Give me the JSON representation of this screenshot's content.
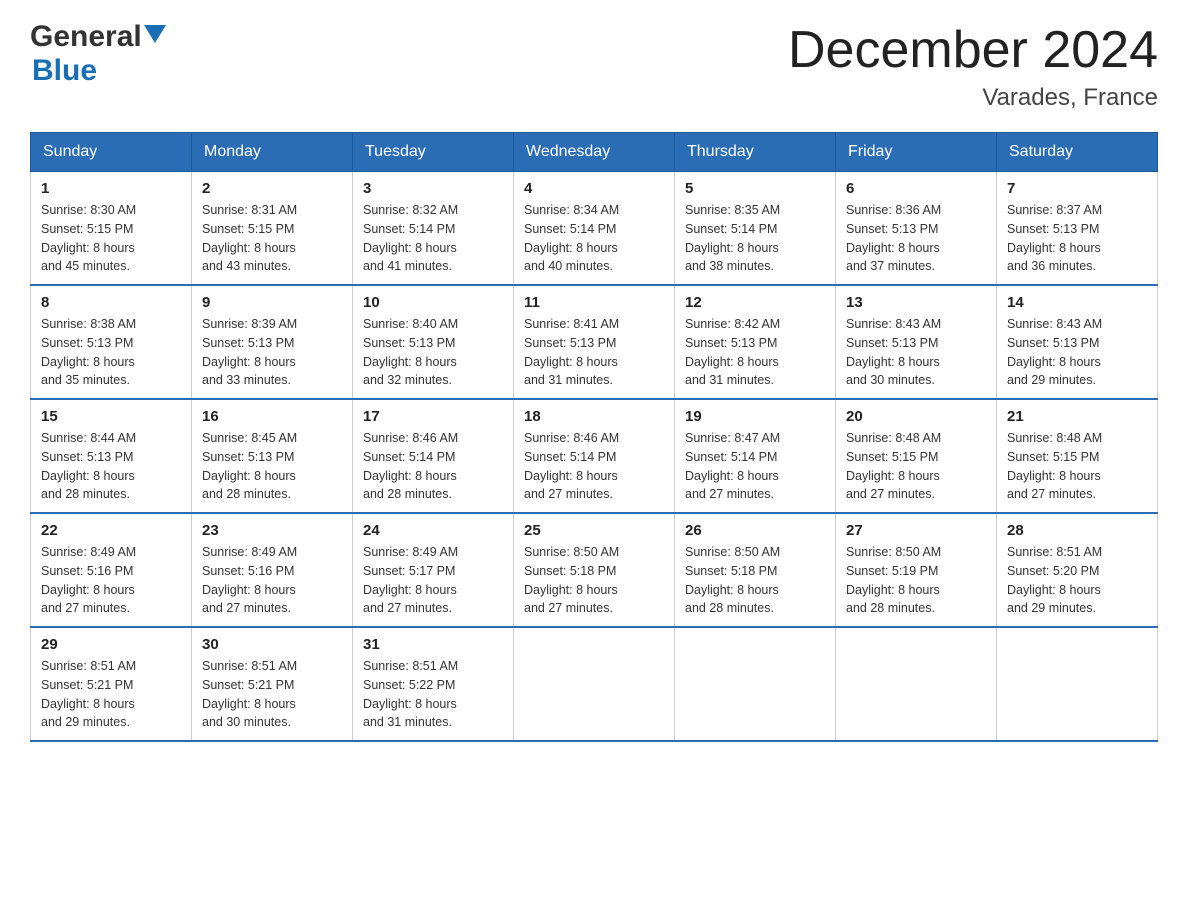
{
  "logo": {
    "general": "General",
    "blue": "Blue"
  },
  "title": "December 2024",
  "subtitle": "Varades, France",
  "days_of_week": [
    "Sunday",
    "Monday",
    "Tuesday",
    "Wednesday",
    "Thursday",
    "Friday",
    "Saturday"
  ],
  "weeks": [
    [
      {
        "day": "1",
        "sunrise": "8:30 AM",
        "sunset": "5:15 PM",
        "daylight": "8 hours and 45 minutes."
      },
      {
        "day": "2",
        "sunrise": "8:31 AM",
        "sunset": "5:15 PM",
        "daylight": "8 hours and 43 minutes."
      },
      {
        "day": "3",
        "sunrise": "8:32 AM",
        "sunset": "5:14 PM",
        "daylight": "8 hours and 41 minutes."
      },
      {
        "day": "4",
        "sunrise": "8:34 AM",
        "sunset": "5:14 PM",
        "daylight": "8 hours and 40 minutes."
      },
      {
        "day": "5",
        "sunrise": "8:35 AM",
        "sunset": "5:14 PM",
        "daylight": "8 hours and 38 minutes."
      },
      {
        "day": "6",
        "sunrise": "8:36 AM",
        "sunset": "5:13 PM",
        "daylight": "8 hours and 37 minutes."
      },
      {
        "day": "7",
        "sunrise": "8:37 AM",
        "sunset": "5:13 PM",
        "daylight": "8 hours and 36 minutes."
      }
    ],
    [
      {
        "day": "8",
        "sunrise": "8:38 AM",
        "sunset": "5:13 PM",
        "daylight": "8 hours and 35 minutes."
      },
      {
        "day": "9",
        "sunrise": "8:39 AM",
        "sunset": "5:13 PM",
        "daylight": "8 hours and 33 minutes."
      },
      {
        "day": "10",
        "sunrise": "8:40 AM",
        "sunset": "5:13 PM",
        "daylight": "8 hours and 32 minutes."
      },
      {
        "day": "11",
        "sunrise": "8:41 AM",
        "sunset": "5:13 PM",
        "daylight": "8 hours and 31 minutes."
      },
      {
        "day": "12",
        "sunrise": "8:42 AM",
        "sunset": "5:13 PM",
        "daylight": "8 hours and 31 minutes."
      },
      {
        "day": "13",
        "sunrise": "8:43 AM",
        "sunset": "5:13 PM",
        "daylight": "8 hours and 30 minutes."
      },
      {
        "day": "14",
        "sunrise": "8:43 AM",
        "sunset": "5:13 PM",
        "daylight": "8 hours and 29 minutes."
      }
    ],
    [
      {
        "day": "15",
        "sunrise": "8:44 AM",
        "sunset": "5:13 PM",
        "daylight": "8 hours and 28 minutes."
      },
      {
        "day": "16",
        "sunrise": "8:45 AM",
        "sunset": "5:13 PM",
        "daylight": "8 hours and 28 minutes."
      },
      {
        "day": "17",
        "sunrise": "8:46 AM",
        "sunset": "5:14 PM",
        "daylight": "8 hours and 28 minutes."
      },
      {
        "day": "18",
        "sunrise": "8:46 AM",
        "sunset": "5:14 PM",
        "daylight": "8 hours and 27 minutes."
      },
      {
        "day": "19",
        "sunrise": "8:47 AM",
        "sunset": "5:14 PM",
        "daylight": "8 hours and 27 minutes."
      },
      {
        "day": "20",
        "sunrise": "8:48 AM",
        "sunset": "5:15 PM",
        "daylight": "8 hours and 27 minutes."
      },
      {
        "day": "21",
        "sunrise": "8:48 AM",
        "sunset": "5:15 PM",
        "daylight": "8 hours and 27 minutes."
      }
    ],
    [
      {
        "day": "22",
        "sunrise": "8:49 AM",
        "sunset": "5:16 PM",
        "daylight": "8 hours and 27 minutes."
      },
      {
        "day": "23",
        "sunrise": "8:49 AM",
        "sunset": "5:16 PM",
        "daylight": "8 hours and 27 minutes."
      },
      {
        "day": "24",
        "sunrise": "8:49 AM",
        "sunset": "5:17 PM",
        "daylight": "8 hours and 27 minutes."
      },
      {
        "day": "25",
        "sunrise": "8:50 AM",
        "sunset": "5:18 PM",
        "daylight": "8 hours and 27 minutes."
      },
      {
        "day": "26",
        "sunrise": "8:50 AM",
        "sunset": "5:18 PM",
        "daylight": "8 hours and 28 minutes."
      },
      {
        "day": "27",
        "sunrise": "8:50 AM",
        "sunset": "5:19 PM",
        "daylight": "8 hours and 28 minutes."
      },
      {
        "day": "28",
        "sunrise": "8:51 AM",
        "sunset": "5:20 PM",
        "daylight": "8 hours and 29 minutes."
      }
    ],
    [
      {
        "day": "29",
        "sunrise": "8:51 AM",
        "sunset": "5:21 PM",
        "daylight": "8 hours and 29 minutes."
      },
      {
        "day": "30",
        "sunrise": "8:51 AM",
        "sunset": "5:21 PM",
        "daylight": "8 hours and 30 minutes."
      },
      {
        "day": "31",
        "sunrise": "8:51 AM",
        "sunset": "5:22 PM",
        "daylight": "8 hours and 31 minutes."
      },
      null,
      null,
      null,
      null
    ]
  ],
  "labels": {
    "sunrise": "Sunrise:",
    "sunset": "Sunset:",
    "daylight": "Daylight:"
  }
}
